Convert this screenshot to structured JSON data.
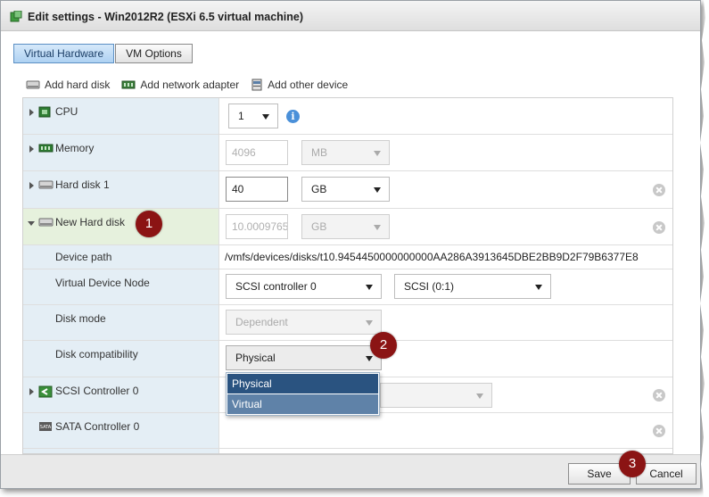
{
  "window": {
    "title": "Edit settings - Win2012R2 (ESXi 6.5 virtual machine)"
  },
  "tabs": [
    {
      "label": "Virtual Hardware",
      "active": true
    },
    {
      "label": "VM Options",
      "active": false
    }
  ],
  "toolbar": {
    "add_hard_disk": "Add hard disk",
    "add_network_adapter": "Add network adapter",
    "add_other_device": "Add other device"
  },
  "rows": {
    "cpu": {
      "label": "CPU",
      "value": "1"
    },
    "memory": {
      "label": "Memory",
      "value": "4096",
      "unit": "MB"
    },
    "hard_disk_1": {
      "label": "Hard disk 1",
      "value": "40",
      "unit": "GB"
    },
    "new_hard_disk": {
      "label": "New Hard disk",
      "value": "10.0009765",
      "unit": "GB"
    },
    "device_path": {
      "label": "Device path",
      "value": "/vmfs/devices/disks/t10.9454450000000000AA286A3913645DBE2BB9D2F79B6377E8"
    },
    "virtual_device_node": {
      "label": "Virtual Device Node",
      "controller": "SCSI controller 0",
      "node": "SCSI (0:1)"
    },
    "disk_mode": {
      "label": "Disk mode",
      "value": "Dependent"
    },
    "disk_compatibility": {
      "label": "Disk compatibility",
      "value": "Physical",
      "options": [
        "Physical",
        "Virtual"
      ]
    },
    "scsi_controller": {
      "label": "SCSI Controller 0"
    },
    "sata_controller": {
      "label": "SATA Controller 0"
    }
  },
  "badges": [
    "1",
    "2",
    "3"
  ],
  "footer": {
    "save": "Save",
    "cancel": "Cancel"
  },
  "colors": {
    "active_tab": "#aed1f2",
    "selected_option": "#2a5380",
    "badge": "#8b1414",
    "info": "#4a90d9"
  }
}
